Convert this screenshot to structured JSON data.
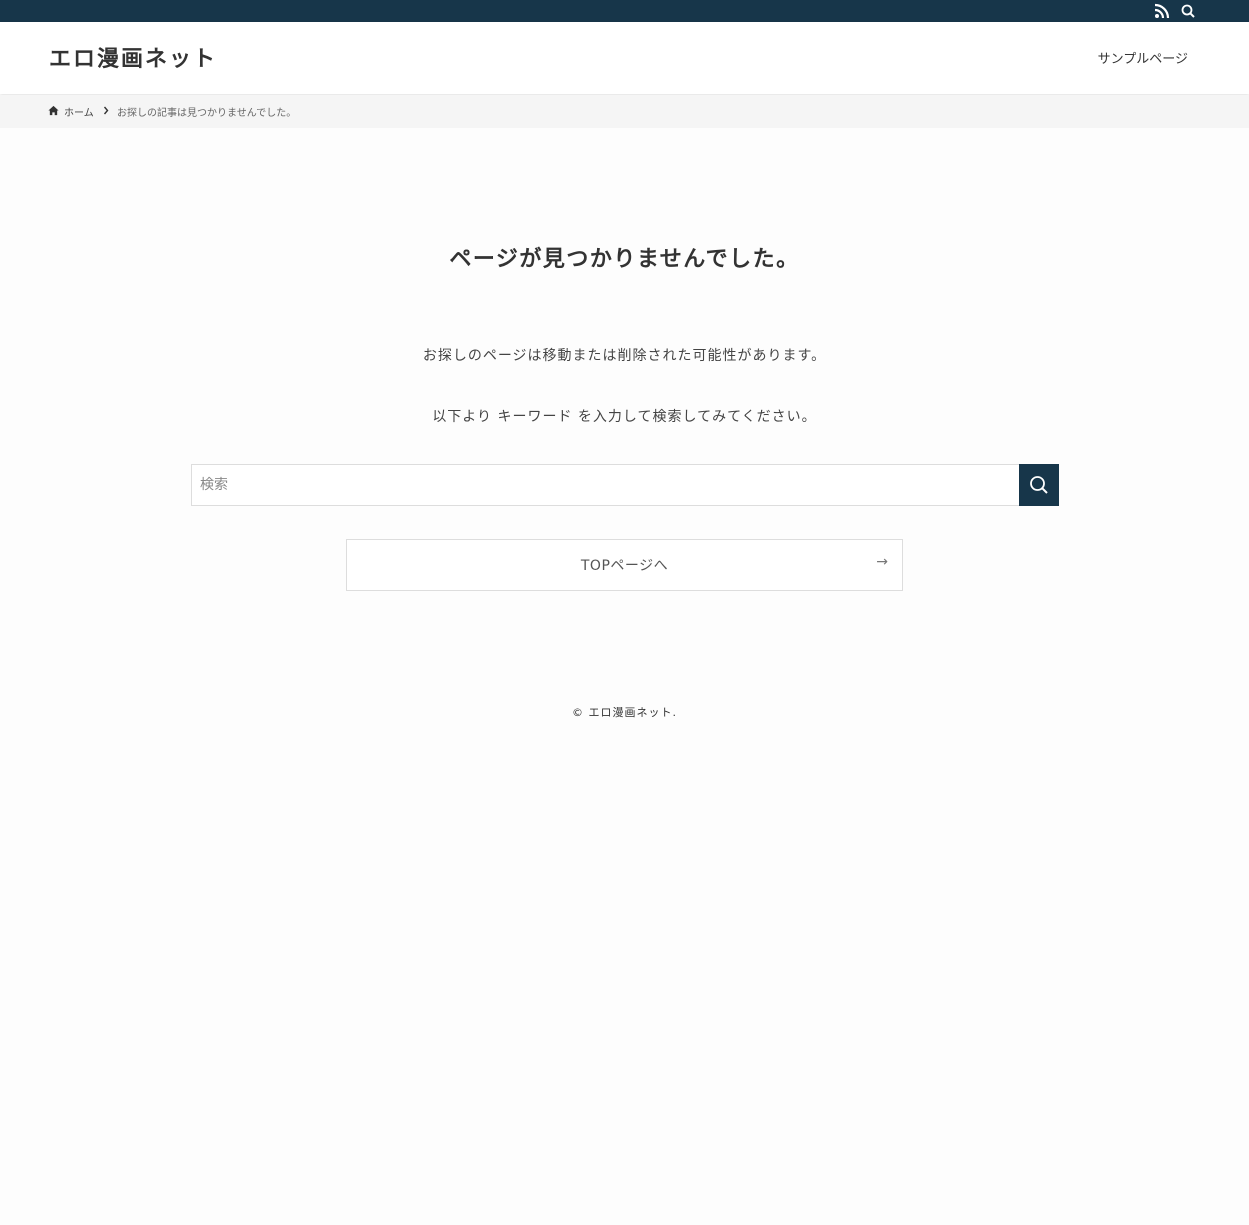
{
  "topbar": {
    "icons": [
      "rss-icon",
      "search-icon"
    ],
    "color": "#17364a"
  },
  "header": {
    "site_title": "エロ漫画ネット",
    "nav": [
      {
        "label": "サンプルページ"
      }
    ]
  },
  "breadcrumb": {
    "home_label": "ホーム",
    "current": "お探しの記事は見つかりませんでした。"
  },
  "main": {
    "heading": "ページが見つかりませんでした。",
    "message1": "お探しのページは移動または削除された可能性があります。",
    "message2": "以下より キーワード を入力して検索してみてください。",
    "search": {
      "placeholder": "検索",
      "value": ""
    },
    "top_button": {
      "label": "TOPページへ",
      "arrow": "→"
    }
  },
  "footer": {
    "copyright": "© エロ漫画ネット."
  }
}
